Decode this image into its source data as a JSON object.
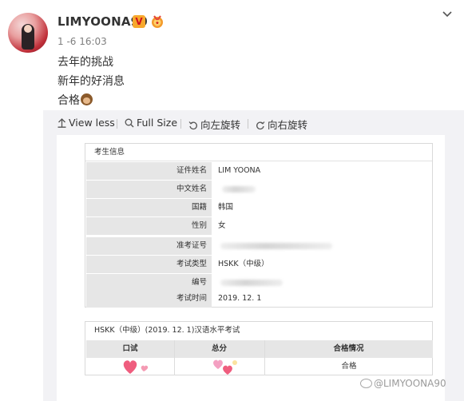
{
  "post": {
    "username": "LIMYOONA90",
    "verified_badge": "V",
    "timestamp": "1 -6 16:03",
    "lines": [
      "去年的挑战",
      "新年的好消息",
      "合格"
    ]
  },
  "toolbar": {
    "view_less": "View less",
    "full_size": "Full Size",
    "rotate_left": "向左旋转",
    "rotate_right": "向右旋转"
  },
  "certificate": {
    "section_title": "考生信息",
    "rows": [
      {
        "label": "证件姓名",
        "value": "LIM YOONA"
      },
      {
        "label": "中文姓名",
        "value": ""
      },
      {
        "label": "国籍",
        "value": "韩国"
      },
      {
        "label": "性别",
        "value": "女"
      },
      {
        "label": "准考证号",
        "value": ""
      },
      {
        "label": "考试类型",
        "value": "HSKK（中级）"
      },
      {
        "label": "编号",
        "value": ""
      },
      {
        "label": "考试时间",
        "value": "2019. 12. 1"
      }
    ],
    "result_title": "HSKK（中级）(2019. 12. 1)汉语水平考试",
    "result_columns": [
      "口试",
      "总分",
      "合格情况"
    ],
    "result_status": "合格"
  },
  "watermark": "@LIMYOONA90",
  "colors": {
    "accent_orange": "#f7a82c",
    "badge_red": "#d1141b",
    "panel_bg": "#f2f2f5",
    "label_bg": "#e6e6e6",
    "heart_pink": "#ef6d8c"
  }
}
